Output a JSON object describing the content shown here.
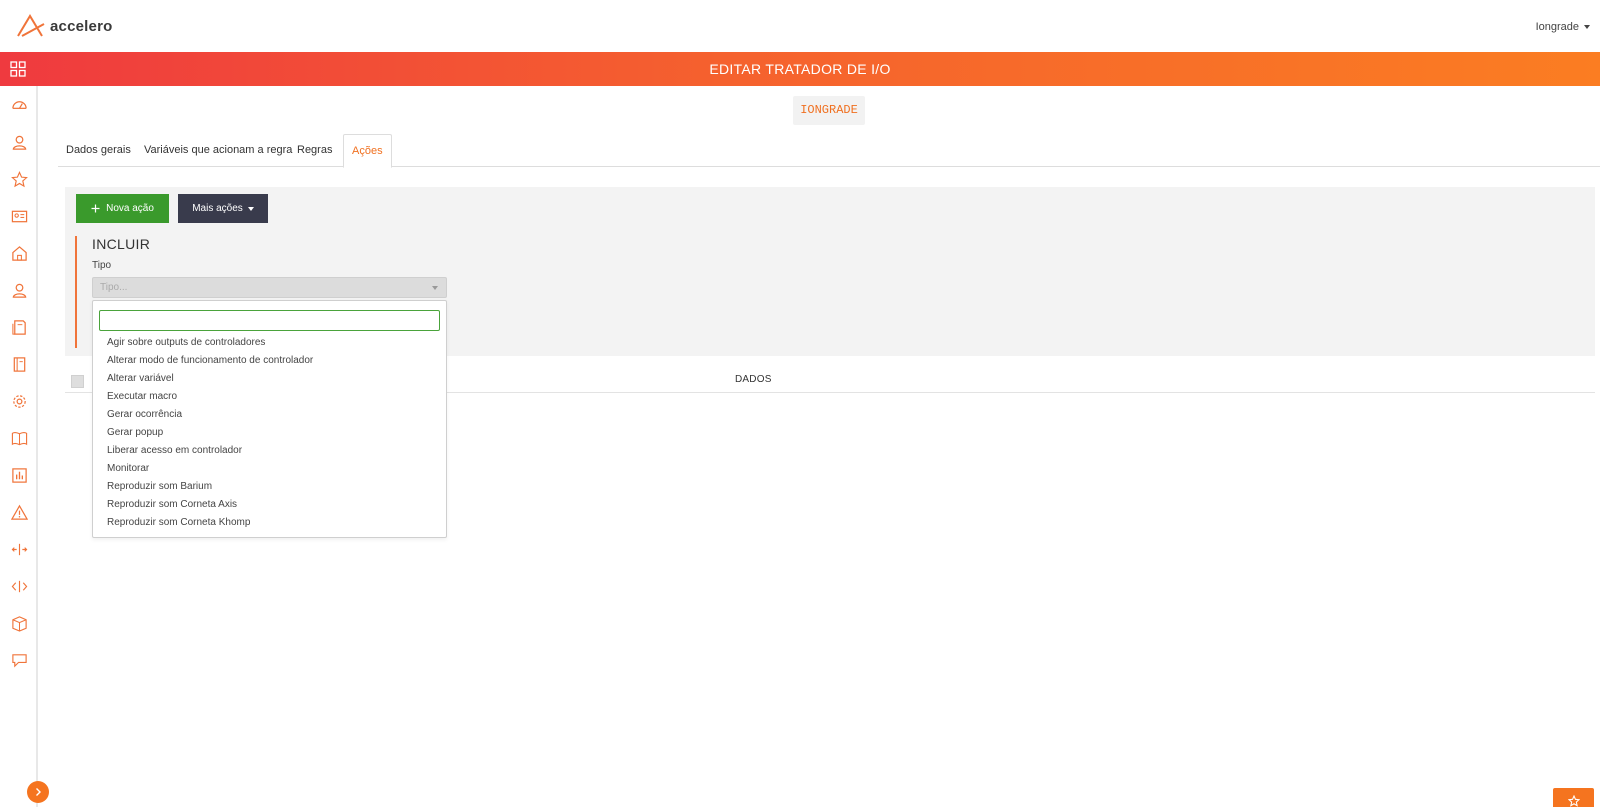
{
  "app": {
    "logo_text": "accelero"
  },
  "user_menu": {
    "label": "Iongrade"
  },
  "header": {
    "title": "EDITAR TRATADOR DE I/O"
  },
  "record": {
    "name": "IONGRADE"
  },
  "tabs": [
    {
      "label": "Dados gerais"
    },
    {
      "label": "Variáveis que acionam a regra"
    },
    {
      "label": "Regras"
    },
    {
      "label": "Ações",
      "active": true
    }
  ],
  "toolbar": {
    "new_action_label": "Nova ação",
    "more_actions_label": "Mais ações"
  },
  "include_form": {
    "title": "INCLUIR",
    "type_label": "Tipo",
    "type_placeholder": "Tipo...",
    "search_value": ""
  },
  "table": {
    "columns": [
      "DADOS"
    ]
  },
  "type_options": [
    "Agir sobre outputs de controladores",
    "Alterar modo de funcionamento de controlador",
    "Alterar variável",
    "Executar macro",
    "Gerar ocorrência",
    "Gerar popup",
    "Liberar acesso em controlador",
    "Monitorar",
    "Reproduzir som Barium",
    "Reproduzir som Corneta Axis",
    "Reproduzir som Corneta Khomp"
  ],
  "sidebar": {
    "icons": [
      "dashboard-gauge-icon",
      "user-icon",
      "star-icon",
      "id-card-icon",
      "home-icon",
      "person-icon",
      "document-icon",
      "notebook-icon",
      "gear-icon",
      "book-icon",
      "chart-icon",
      "warning-icon",
      "arrows-expand-icon",
      "code-icon",
      "package-icon",
      "speech-bubble-icon"
    ]
  },
  "colors": {
    "accent": "#f07020",
    "success": "#3a9a2c",
    "dark_button": "#393b4c",
    "header_start": "#ef3a3f",
    "header_end": "#fb7d22"
  }
}
